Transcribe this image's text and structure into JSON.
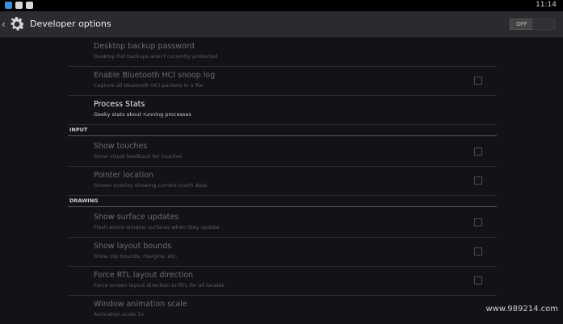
{
  "statusbar": {
    "time": "11:14"
  },
  "actionbar": {
    "title": "Developer options",
    "toggle_label": "OFF"
  },
  "items": [
    {
      "title": "Desktop backup password",
      "subtitle": "Desktop full backups aren't currently protected",
      "enabled": false,
      "checkbox": false
    },
    {
      "title": "Enable Bluetooth HCI snoop log",
      "subtitle": "Capture all bluetooth HCI packets in a file",
      "enabled": false,
      "checkbox": true
    },
    {
      "title": "Process Stats",
      "subtitle": "Geeky stats about running processes",
      "enabled": true,
      "checkbox": false
    },
    {
      "title": "Show touches",
      "subtitle": "Show visual feedback for touches",
      "enabled": false,
      "checkbox": true
    },
    {
      "title": "Pointer location",
      "subtitle": "Screen overlay showing current touch data",
      "enabled": false,
      "checkbox": true
    },
    {
      "title": "Show surface updates",
      "subtitle": "Flash entire window surfaces when they update",
      "enabled": false,
      "checkbox": true
    },
    {
      "title": "Show layout bounds",
      "subtitle": "Show clip bounds, margins, etc.",
      "enabled": false,
      "checkbox": true
    },
    {
      "title": "Force RTL layout direction",
      "subtitle": "Force screen layout direction to RTL for all locales",
      "enabled": false,
      "checkbox": true
    },
    {
      "title": "Window animation scale",
      "subtitle": "Animation scale 1x",
      "enabled": false,
      "checkbox": false
    }
  ],
  "sections": {
    "input": "INPUT",
    "drawing": "DRAWING"
  },
  "watermark": "www.989214.com"
}
